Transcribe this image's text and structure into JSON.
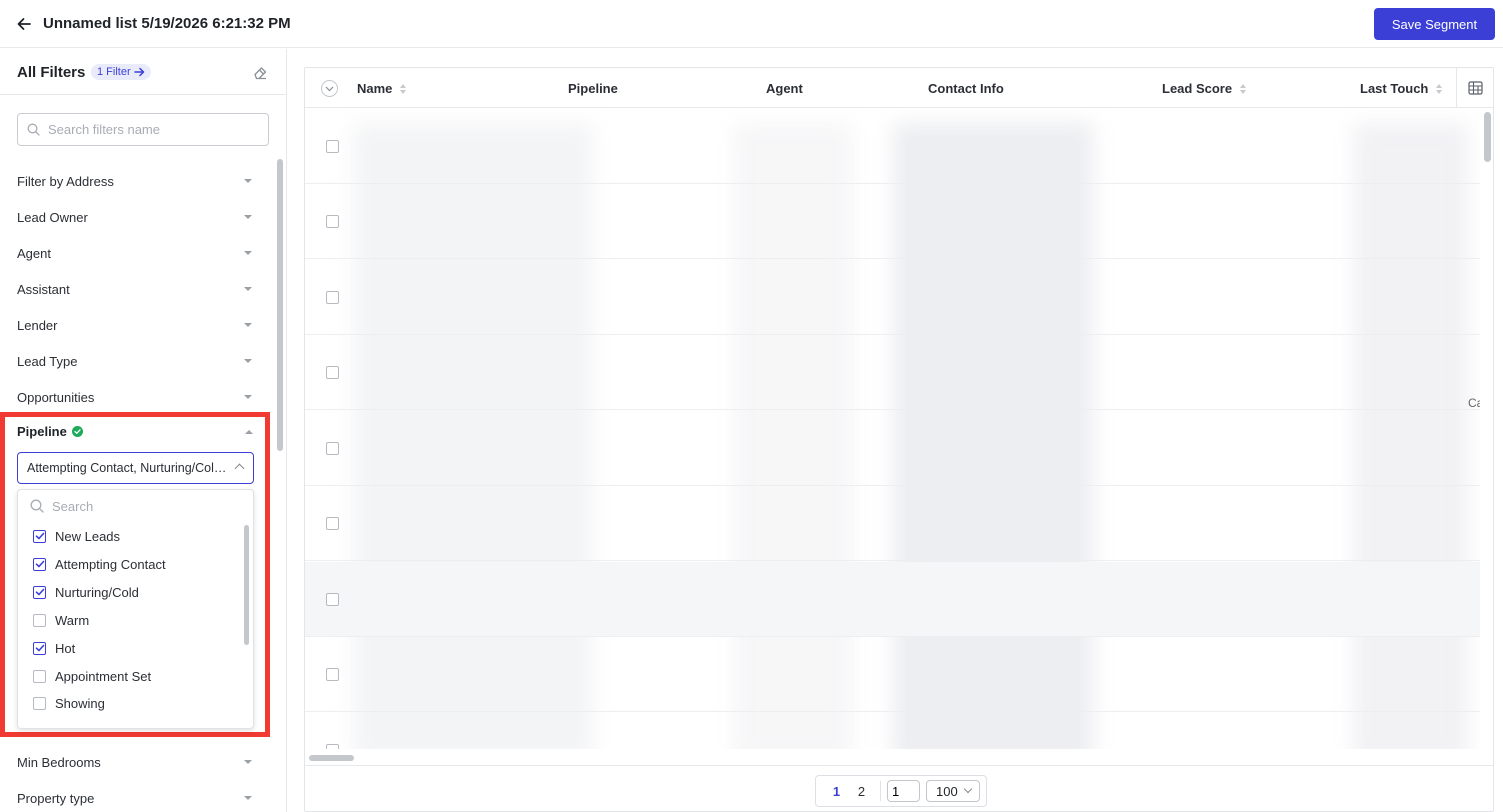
{
  "header": {
    "title": "Unnamed list 5/19/2026 6:21:32 PM",
    "save_label": "Save Segment"
  },
  "sidebar": {
    "title": "All Filters",
    "badge": "1 Filter",
    "search_placeholder": "Search filters name",
    "filters": [
      {
        "label": "Filter by Address"
      },
      {
        "label": "Lead Owner"
      },
      {
        "label": "Agent"
      },
      {
        "label": "Assistant"
      },
      {
        "label": "Lender"
      },
      {
        "label": "Lead Type"
      },
      {
        "label": "Opportunities"
      }
    ],
    "pipeline": {
      "label": "Pipeline",
      "selected_value": "Attempting Contact, Nurturing/Cold, New Leads, Hot",
      "search_placeholder": "Search",
      "options": [
        {
          "label": "New Leads",
          "checked": true
        },
        {
          "label": "Attempting Contact",
          "checked": true
        },
        {
          "label": "Nurturing/Cold",
          "checked": true
        },
        {
          "label": "Warm",
          "checked": false
        },
        {
          "label": "Hot",
          "checked": true
        },
        {
          "label": "Appointment Set",
          "checked": false
        },
        {
          "label": "Showing",
          "checked": false
        }
      ]
    },
    "filters_after": [
      {
        "label": "Min Bedrooms"
      },
      {
        "label": "Property type"
      }
    ]
  },
  "table": {
    "columns": [
      {
        "label": "Name",
        "sortable": true
      },
      {
        "label": "Pipeline",
        "sortable": false
      },
      {
        "label": "Agent",
        "sortable": false
      },
      {
        "label": "Contact Info",
        "sortable": false
      },
      {
        "label": "Lead Score",
        "sortable": true
      },
      {
        "label": "Last Touch",
        "sortable": true
      }
    ],
    "truncated_cell_text": "Ca",
    "pagination": {
      "pages": [
        "1",
        "2"
      ],
      "current_page": "1",
      "jump_value": "1",
      "page_size": "100"
    }
  },
  "colors": {
    "accent": "#3b3fd6",
    "highlight_border": "#f03a32",
    "status_green": "#1faa59"
  }
}
